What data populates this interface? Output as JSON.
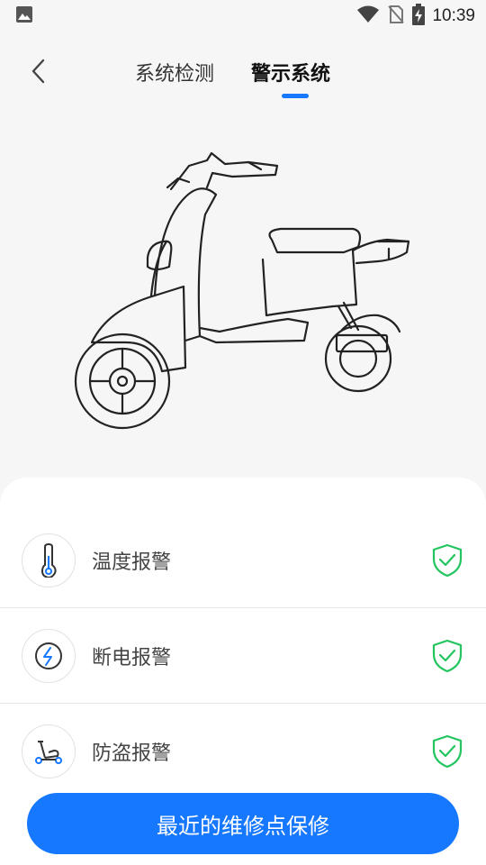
{
  "status_bar": {
    "time": "10:39",
    "icons": [
      "image-icon",
      "wifi-icon",
      "no-sim-icon",
      "battery-charging-icon"
    ]
  },
  "header": {
    "back_icon": "chevron-left-icon",
    "tabs": [
      {
        "label": "系统检测",
        "active": false
      },
      {
        "label": "警示系统",
        "active": true
      }
    ],
    "accent_color": "#1677ff"
  },
  "alerts": [
    {
      "icon": "thermometer-icon",
      "label": "温度报警",
      "status_icon": "shield-check-icon"
    },
    {
      "icon": "power-off-icon",
      "label": "断电报警",
      "status_icon": "shield-check-icon"
    },
    {
      "icon": "scooter-lock-icon",
      "label": "防盗报警",
      "status_icon": "shield-check-icon"
    }
  ],
  "status_color": "#22c55e",
  "cta_label": "最近的维修点保修"
}
